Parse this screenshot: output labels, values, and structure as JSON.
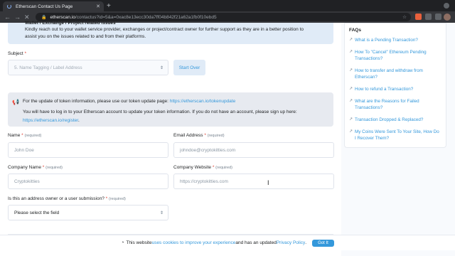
{
  "browser": {
    "tab_title": "Etherscan Contact Us Page",
    "url_host": "etherscan.io",
    "url_path": "/contactus?id=5&a=0xac8e13ecc30da7ff04b842f21a62a1fb0f10ebd5"
  },
  "notice_top": {
    "title": "Wallet / Exchange / Project related issues",
    "text": "Kindly reach out to your wallet service provider, exchanges or project/contract owner for further support as they are in a better position to assist you on the issues related to and from their platforms."
  },
  "subject": {
    "label": "Subject",
    "value": "5. Name Tagging / Label Address",
    "start_over": "Start Over"
  },
  "notice_token": {
    "line1": "For the update of token information, please use our token update page: ",
    "line1_link": "https://etherscan.io/tokenupdate",
    "line2": "You will have to log in to your Etherscan account to update your token information. If you do not have an account, please sign up here: ",
    "line2_link": "https://etherscan.io/register",
    "line2_end": "."
  },
  "form": {
    "required_text": "(required)",
    "name_label": "Name",
    "name_placeholder": "John Doe",
    "email_label": "Email Address",
    "email_placeholder": "johndoe@cryptokitties.com",
    "company_label": "Company Name",
    "company_placeholder": "Cryptokitties",
    "website_label": "Company Website",
    "website_placeholder": "https://cryptokitties.com",
    "owner_label": "Is this an address owner or a user submission?",
    "owner_select": "Please select the field"
  },
  "faqs": {
    "title": "FAQs",
    "items": [
      "What is a Pending Transaction?",
      "How To \"Cancel\" Ethereum Pending Transactions?",
      "How to transfer and withdraw from Etherscan?",
      "How to refund a Transaction?",
      "What are the Reasons for Failed Transactions?",
      "Transaction Dropped & Replaced?",
      "My Coins Were Sent To Your Site, How Do I Recover Them?"
    ]
  },
  "cookie": {
    "text1": "This website ",
    "link1": "uses cookies to improve your experience",
    "text2": " and has an updated ",
    "link2": "Privacy Policy",
    "text3": ".",
    "button": "Got It"
  },
  "colors": {
    "accent": "#3498db",
    "required_star": "#de4437"
  }
}
